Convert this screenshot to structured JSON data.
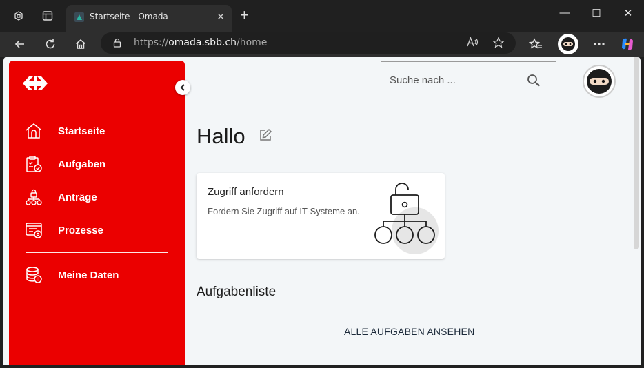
{
  "browser": {
    "tab_title": "Startseite - Omada",
    "tab_close": "✕",
    "new_tab": "+",
    "url_scheme": "https://",
    "url_host": "omada.sbb.ch",
    "url_path": "/home",
    "window_controls": {
      "minimize": "—",
      "maximize": "☐",
      "close": "✕"
    }
  },
  "sidebar": {
    "items": [
      {
        "label": "Startseite",
        "icon": "home-icon"
      },
      {
        "label": "Aufgaben",
        "icon": "clipboard-check-icon"
      },
      {
        "label": "Anträge",
        "icon": "hierarchy-icon"
      },
      {
        "label": "Prozesse",
        "icon": "process-icon"
      },
      {
        "label": "Meine Daten",
        "icon": "database-icon"
      }
    ]
  },
  "search": {
    "placeholder": "Suche nach ..."
  },
  "main": {
    "greeting": "Hallo",
    "card": {
      "title": "Zugriff anfordern",
      "description": "Fordern Sie Zugriff auf IT-Systeme an."
    },
    "tasks_title": "Aufgabenliste",
    "all_tasks_link": "ALLE AUFGABEN ANSEHEN"
  },
  "colors": {
    "brand_red": "#eb0000",
    "page_bg": "#f3f6f8"
  }
}
